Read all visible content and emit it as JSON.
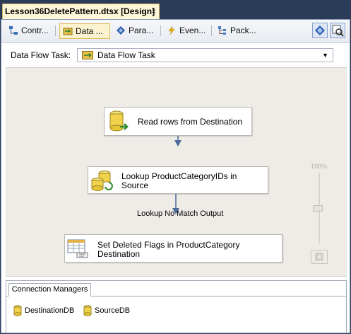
{
  "document_tab": {
    "title": "Lesson36DeletePattern.dtsx [Design]",
    "close_glyph": "×"
  },
  "designer_tabs": [
    {
      "label": "Contr...",
      "icon": "control-flow-icon"
    },
    {
      "label": "Data ...",
      "icon": "data-flow-icon"
    },
    {
      "label": "Para...",
      "icon": "parameters-icon"
    },
    {
      "label": "Even...",
      "icon": "event-handlers-icon"
    },
    {
      "label": "Pack...",
      "icon": "package-explorer-icon"
    }
  ],
  "active_tab": "Data ...",
  "toolbar_buttons": [
    "variables-icon",
    "zoom-icon"
  ],
  "task_selector": {
    "label": "Data Flow Task:",
    "value": "Data Flow Task"
  },
  "flow": {
    "nodes": [
      {
        "title": "Read rows from Destination",
        "icon": "ole-db-source-icon"
      },
      {
        "title_line1": "Lookup ProductCategoryIDs in",
        "title_line2": "Source",
        "icon": "lookup-icon"
      },
      {
        "title_line1": "Set Deleted Flags in ProductCategory",
        "title_line2": "Destination",
        "icon": "ole-db-command-icon"
      }
    ],
    "path_label": "Lookup No Match Output"
  },
  "zoom": {
    "percent_label": "100%",
    "level_percent": 100
  },
  "connection_managers": {
    "tab_label": "Connection Managers",
    "items": [
      "DestinationDB",
      "SourceDB"
    ]
  },
  "colors": {
    "canvas_bg": "#efece8",
    "flow_arrow": "#4a6a9a",
    "active_tab_bg": "#fbf3d0",
    "frame": "#2b3c59"
  }
}
